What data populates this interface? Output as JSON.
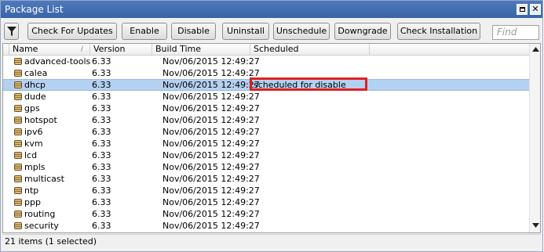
{
  "window": {
    "title": "Package List",
    "restore_icon": "restore-icon",
    "close_icon": "close-icon",
    "close_glyph": "✕"
  },
  "toolbar": {
    "filter_icon": "filter-icon",
    "buttons": [
      "Check For Updates",
      "Enable",
      "Disable",
      "Uninstall",
      "Unschedule",
      "Downgrade",
      "Check Installation"
    ],
    "find_placeholder": "Find"
  },
  "table": {
    "columns": [
      "Name",
      "Version",
      "Build Time",
      "Scheduled"
    ],
    "sort_indicator": "/",
    "rows": [
      {
        "name": "advanced-tools",
        "version": "6.33",
        "build": "Nov/06/2015 12:49:27",
        "scheduled": ""
      },
      {
        "name": "calea",
        "version": "6.33",
        "build": "Nov/06/2015 12:49:27",
        "scheduled": ""
      },
      {
        "name": "dhcp",
        "version": "6.33",
        "build": "Nov/06/2015 12:49:27",
        "scheduled": "scheduled for disable"
      },
      {
        "name": "dude",
        "version": "6.33",
        "build": "Nov/06/2015 12:49:27",
        "scheduled": ""
      },
      {
        "name": "gps",
        "version": "6.33",
        "build": "Nov/06/2015 12:49:27",
        "scheduled": ""
      },
      {
        "name": "hotspot",
        "version": "6.33",
        "build": "Nov/06/2015 12:49:27",
        "scheduled": ""
      },
      {
        "name": "ipv6",
        "version": "6.33",
        "build": "Nov/06/2015 12:49:27",
        "scheduled": ""
      },
      {
        "name": "kvm",
        "version": "6.33",
        "build": "Nov/06/2015 12:49:27",
        "scheduled": ""
      },
      {
        "name": "lcd",
        "version": "6.33",
        "build": "Nov/06/2015 12:49:27",
        "scheduled": ""
      },
      {
        "name": "mpls",
        "version": "6.33",
        "build": "Nov/06/2015 12:49:27",
        "scheduled": ""
      },
      {
        "name": "multicast",
        "version": "6.33",
        "build": "Nov/06/2015 12:49:27",
        "scheduled": ""
      },
      {
        "name": "ntp",
        "version": "6.33",
        "build": "Nov/06/2015 12:49:27",
        "scheduled": ""
      },
      {
        "name": "ppp",
        "version": "6.33",
        "build": "Nov/06/2015 12:49:27",
        "scheduled": ""
      },
      {
        "name": "routing",
        "version": "6.33",
        "build": "Nov/06/2015 12:49:27",
        "scheduled": ""
      },
      {
        "name": "security",
        "version": "6.33",
        "build": "Nov/06/2015 12:49:27",
        "scheduled": ""
      }
    ],
    "selected_index": 2,
    "package_icon": "package-icon"
  },
  "status": {
    "text": "21 items (1 selected)"
  },
  "colors": {
    "titlebar": "#4a74b8",
    "selection": "#b5d1f1",
    "highlight": "#e02020"
  }
}
